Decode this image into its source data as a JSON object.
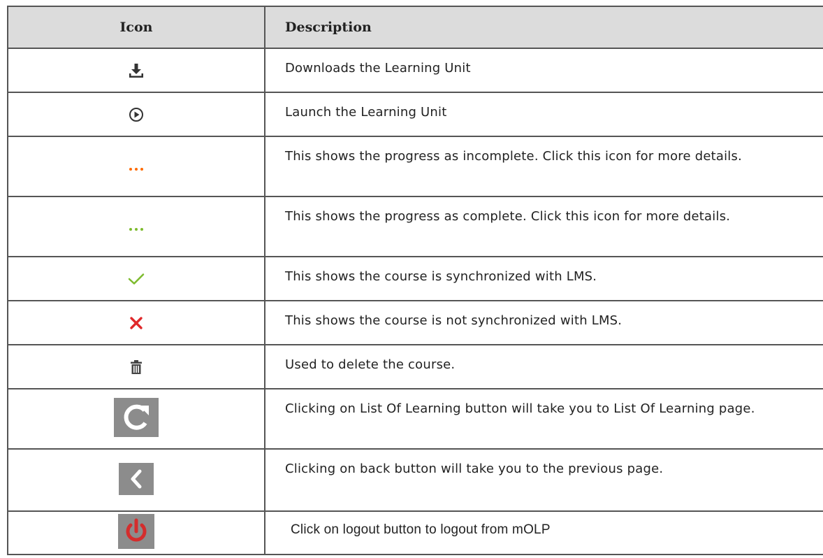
{
  "header": {
    "icon_label": "Icon",
    "description_label": "Description"
  },
  "colors": {
    "header_bg": "#dcdcdc",
    "incomplete_dots": "#ff6a00",
    "complete_dots": "#7dbb2e",
    "check": "#7dbb2e",
    "cross": "#e0282a",
    "button_bg": "#8c8c8c",
    "logout_icon": "#d42d2d"
  },
  "rows": [
    {
      "icon": "download-icon",
      "description": "Downloads the Learning Unit"
    },
    {
      "icon": "play-circle-icon",
      "description": "Launch the Learning Unit"
    },
    {
      "icon": "orange-dots-icon",
      "description": "This shows the progress as incomplete. Click this icon for more details."
    },
    {
      "icon": "green-dots-icon",
      "description": "This shows the progress as complete. Click this icon for more details."
    },
    {
      "icon": "checkmark-icon",
      "description": "This shows the course is synchronized with LMS."
    },
    {
      "icon": "cross-icon",
      "description": "This shows the course is not synchronized with LMS."
    },
    {
      "icon": "trash-icon",
      "description": "Used to delete the course."
    },
    {
      "icon": "refresh-button-icon",
      "description": "Clicking on List Of Learning button will take you to List Of Learning page."
    },
    {
      "icon": "back-button-icon",
      "description": "Clicking on back button will take you to the previous page."
    },
    {
      "icon": "logout-button-icon",
      "description": "Click on logout button to logout from mOLP"
    }
  ]
}
